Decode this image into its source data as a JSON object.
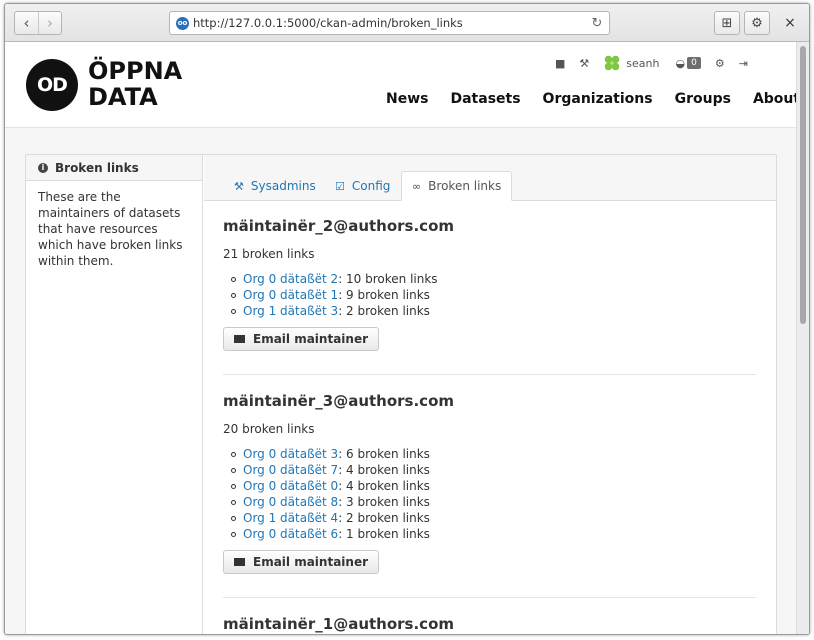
{
  "browser": {
    "url": "http://127.0.0.1:5000/ckan-admin/broken_links",
    "back_icon": "chevron-left-icon",
    "forward_icon": "chevron-right-icon",
    "reload_icon": "reload-icon",
    "close_label": "×"
  },
  "site": {
    "logo_mark": "OD",
    "logo_line1": "ÖPPNA",
    "logo_line2": "DATA",
    "account": {
      "username": "seanh",
      "activity_count": "0"
    },
    "nav": [
      "News",
      "Datasets",
      "Organizations",
      "Groups",
      "About"
    ]
  },
  "sidebar": {
    "title": "Broken links",
    "text": "These are the maintainers of datasets that have resources which have broken links within them."
  },
  "tabs": [
    {
      "label": "Sysadmins",
      "icon": "hammer-icon",
      "active": false
    },
    {
      "label": "Config",
      "icon": "check-square-icon",
      "active": false
    },
    {
      "label": "Broken links",
      "icon": "link-icon",
      "active": true
    }
  ],
  "maintainers": [
    {
      "email": "mäintainër_2@authors.com",
      "count": "21 broken links",
      "datasets": [
        {
          "name": "Org 0 dätaßët 2",
          "links": ": 10 broken links"
        },
        {
          "name": "Org 0 dätaßët 1",
          "links": ": 9 broken links"
        },
        {
          "name": "Org 1 dätaßët 3",
          "links": ": 2 broken links"
        }
      ],
      "button": "Email maintainer"
    },
    {
      "email": "mäintainër_3@authors.com",
      "count": "20 broken links",
      "datasets": [
        {
          "name": "Org 0 dätaßët 3",
          "links": ": 6 broken links"
        },
        {
          "name": "Org 0 dätaßët 7",
          "links": ": 4 broken links"
        },
        {
          "name": "Org 0 dätaßët 0",
          "links": ": 4 broken links"
        },
        {
          "name": "Org 0 dätaßët 8",
          "links": ": 3 broken links"
        },
        {
          "name": "Org 1 dätaßët 4",
          "links": ": 2 broken links"
        },
        {
          "name": "Org 0 dätaßët 6",
          "links": ": 1 broken links"
        }
      ],
      "button": "Email maintainer"
    },
    {
      "email": "mäintainër_1@authors.com"
    }
  ]
}
